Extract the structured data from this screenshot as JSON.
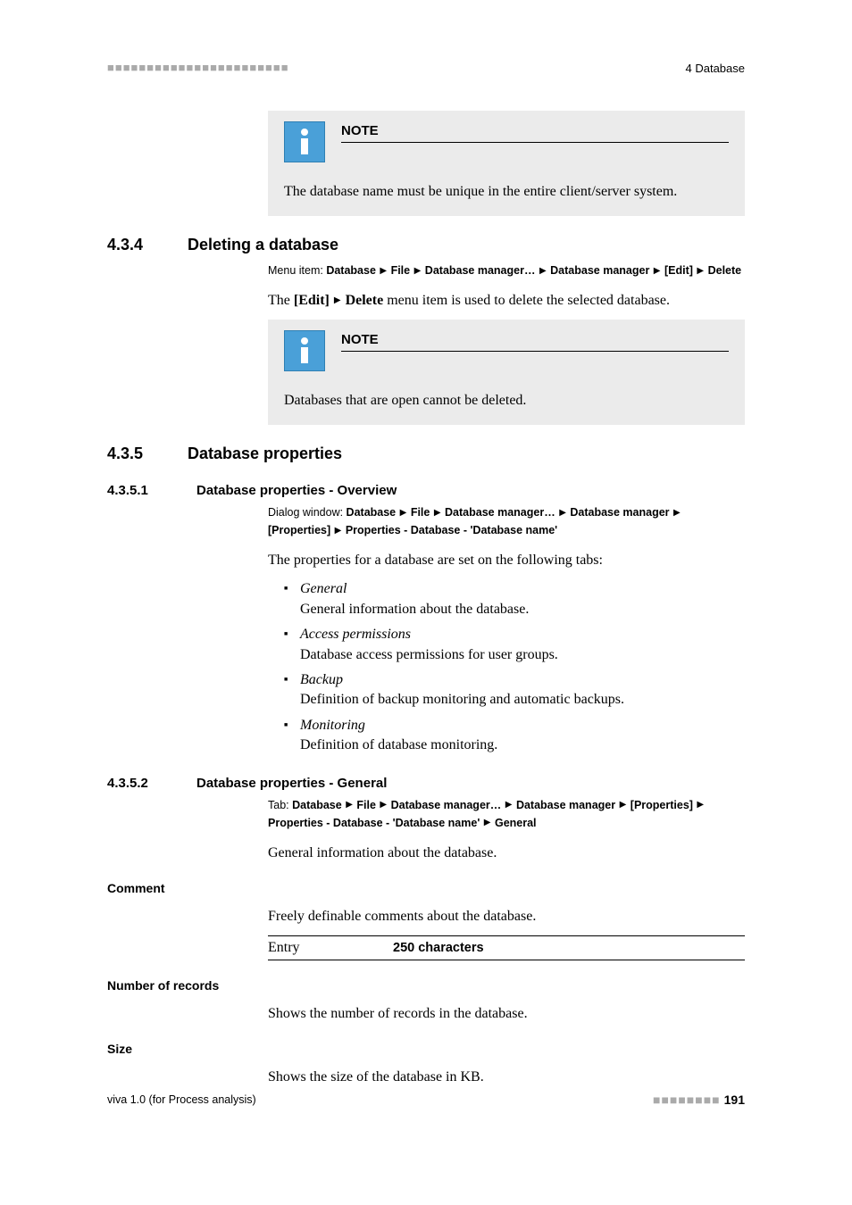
{
  "header": {
    "dots": "■■■■■■■■■■■■■■■■■■■■■■■",
    "right": "4 Database"
  },
  "note1": {
    "title": "NOTE",
    "body": "The database name must be unique in the entire client/server system."
  },
  "sec434": {
    "num": "4.3.4",
    "title": "Deleting a database",
    "path_prefix": "Menu item: ",
    "path_seg": [
      "Database",
      "File",
      "Database manager…",
      "Database manager",
      "[Edit]",
      "Delete"
    ],
    "body_pre": "The ",
    "body_b1": "[Edit]",
    "body_b2": "Delete",
    "body_post": " menu item is used to delete the selected database."
  },
  "note2": {
    "title": "NOTE",
    "body": "Databases that are open cannot be deleted."
  },
  "sec435": {
    "num": "4.3.5",
    "title": "Database properties"
  },
  "sec4351": {
    "num": "4.3.5.1",
    "title": "Database properties - Overview",
    "path_prefix": "Dialog window: ",
    "path_seg": [
      "Database",
      "File",
      "Database manager…",
      "Database manager",
      "[Properties]",
      "Properties - Database - 'Database name'"
    ],
    "intro": "The properties for a database are set on the following tabs:",
    "items": [
      {
        "name": "General",
        "desc": "General information about the database."
      },
      {
        "name": "Access permissions",
        "desc": "Database access permissions for user groups."
      },
      {
        "name": "Backup",
        "desc": "Definition of backup monitoring and automatic backups."
      },
      {
        "name": "Monitoring",
        "desc": "Definition of database monitoring."
      }
    ]
  },
  "sec4352": {
    "num": "4.3.5.2",
    "title": "Database properties - General",
    "path_prefix": "Tab: ",
    "path_seg": [
      "Database",
      "File",
      "Database manager…",
      "Database manager",
      "[Properties]",
      "Properties - Database - 'Database name'",
      "General"
    ],
    "intro": "General information about the database."
  },
  "field_comment": {
    "label": "Comment",
    "desc": "Freely definable comments about the database.",
    "entry_label": "Entry",
    "entry_value": "250 characters"
  },
  "field_records": {
    "label": "Number of records",
    "desc": "Shows the number of records in the database."
  },
  "field_size": {
    "label": "Size",
    "desc": "Shows the size of the database in KB."
  },
  "footer": {
    "left": "viva 1.0 (for Process analysis)",
    "dots": "■■■■■■■■",
    "page": "191"
  }
}
